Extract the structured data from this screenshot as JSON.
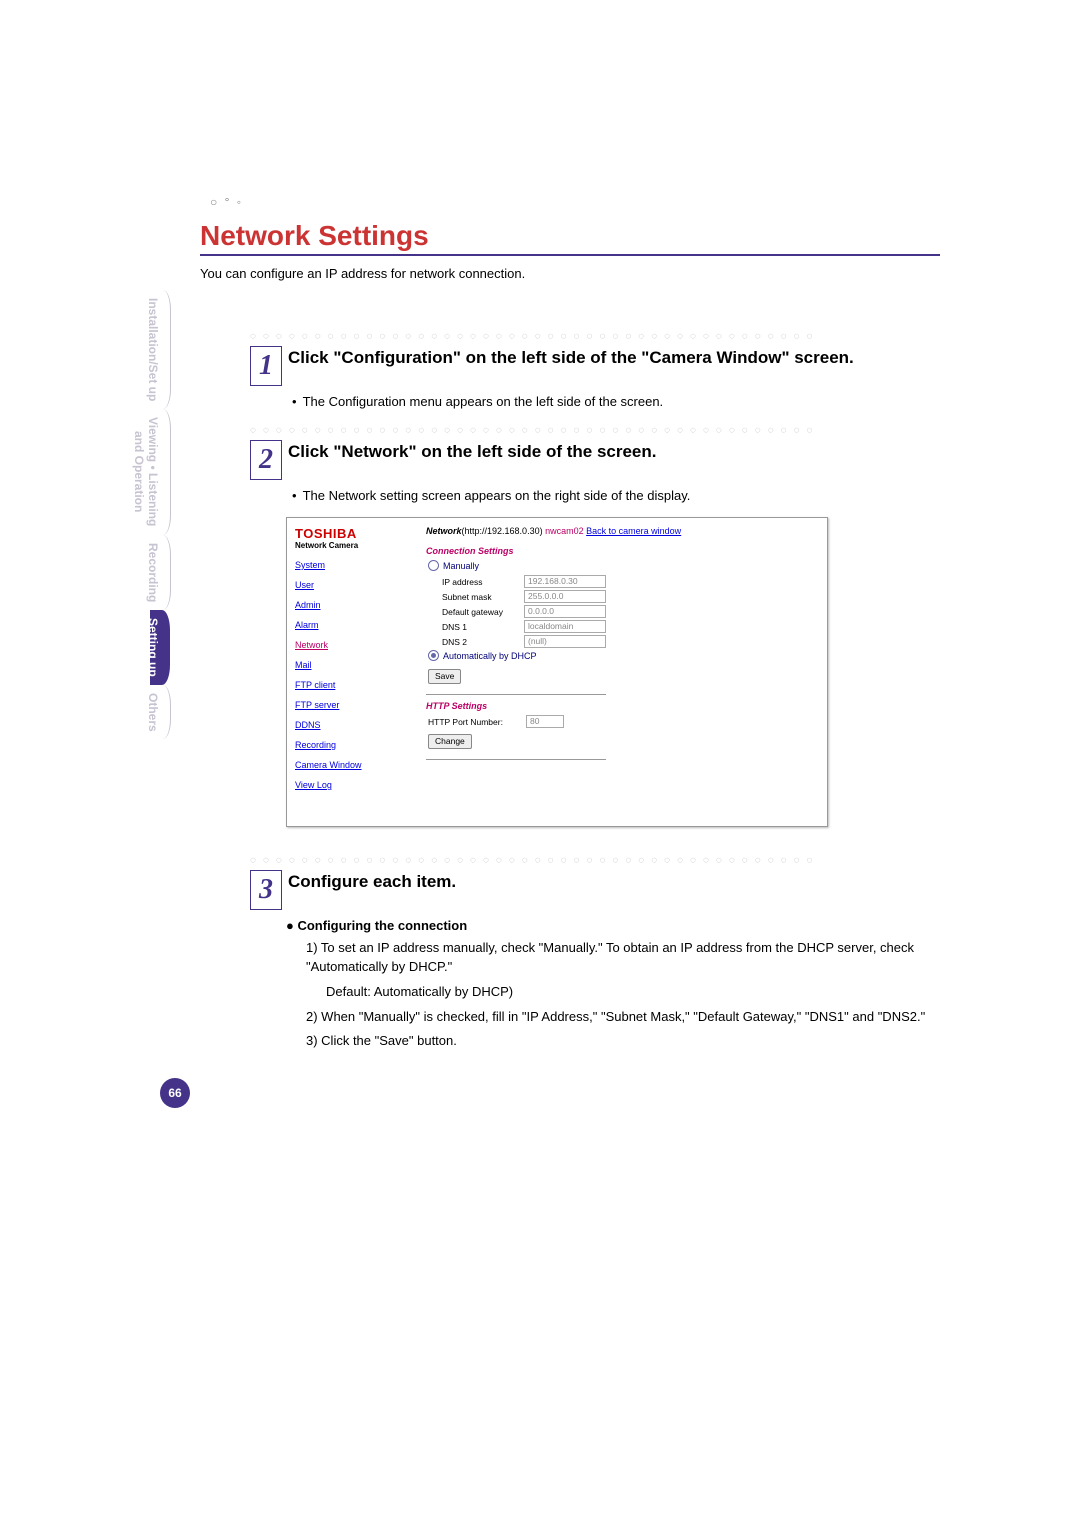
{
  "page_number": "66",
  "title": "Network Settings",
  "intro": "You can configure an IP address for network connection.",
  "side_tabs": {
    "t1": "Installation/Set up",
    "t2": "Viewing • Listening\nand Operation",
    "t3": "Recording",
    "t4": "Setting up",
    "t5": "Others"
  },
  "steps": {
    "s1": {
      "num": "1",
      "title": "Click \"Configuration\" on the left side of the \"Camera Window\" screen.",
      "bullet": "The Configuration menu appears on the left side of the screen."
    },
    "s2": {
      "num": "2",
      "title": "Click \"Network\" on the left side of the screen.",
      "bullet": "The Network setting screen appears on the right side of the display."
    },
    "s3": {
      "num": "3",
      "title": "Configure each item.",
      "sub": "Configuring the connection",
      "i1": "1) To set an IP address manually, check \"Manually.\" To obtain an IP address from the DHCP server, check \"Automatically by DHCP.\"",
      "i1d": "Default: Automatically by DHCP)",
      "i2": "2) When \"Manually\" is checked, fill in \"IP Address,\" \"Subnet Mask,\" \"Default Gateway,\" \"DNS1\" and \"DNS2.\"",
      "i3": "3) Click the \"Save\" button."
    }
  },
  "screenshot": {
    "brand": "TOSHIBA",
    "brand_sub": "Network Camera",
    "menu": {
      "system": "System",
      "user": "User",
      "admin": "Admin",
      "alarm": "Alarm",
      "network": "Network",
      "mail": "Mail",
      "ftpc": "FTP client",
      "ftps": "FTP server",
      "ddns": "DDNS",
      "recording": "Recording",
      "camwin": "Camera Window",
      "viewlog": "View Log"
    },
    "breadcrumb_label": "Network",
    "breadcrumb_host": "(http://192.168.0.30)",
    "breadcrumb_cam": "nwcam02",
    "breadcrumb_back": "Back to camera window",
    "conn_heading": "Connection Settings",
    "manually": "Manually",
    "auto": "Automatically by DHCP",
    "fields": {
      "ip_lbl": "IP address",
      "ip": "192.168.0.30",
      "mask_lbl": "Subnet mask",
      "mask": "255.0.0.0",
      "gw_lbl": "Default gateway",
      "gw": "0.0.0.0",
      "dns1_lbl": "DNS 1",
      "dns1": "localdomain",
      "dns2_lbl": "DNS 2",
      "dns2": "(null)"
    },
    "save_btn": "Save",
    "http_heading": "HTTP Settings",
    "http_port_lbl": "HTTP Port Number:",
    "http_port": "80",
    "change_btn": "Change"
  }
}
